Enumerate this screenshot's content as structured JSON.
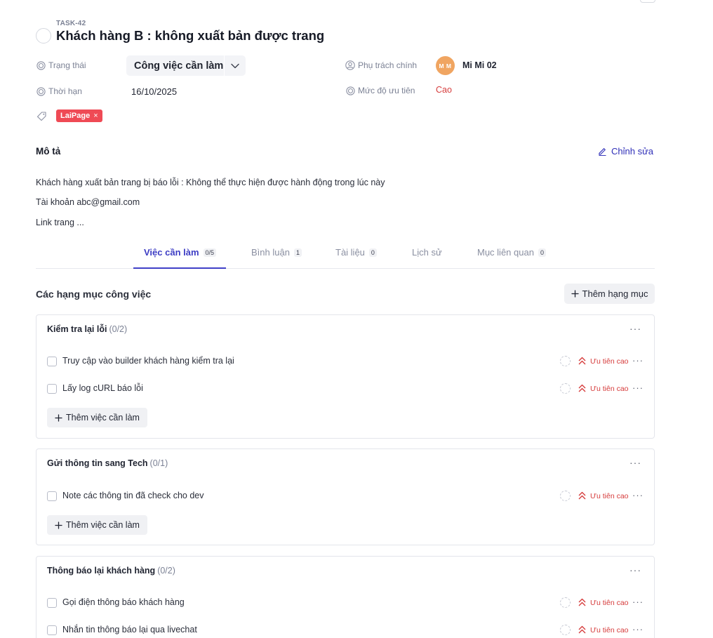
{
  "task": {
    "code": "TASK-42",
    "title": "Khách hàng B : không xuất bản được trang"
  },
  "fields": {
    "status_label": "Trạng thái",
    "status_value": "Công việc cần làm",
    "deadline_label": "Thời hạn",
    "deadline_value": "16/10/2025",
    "assignee_label": "Phụ trách chính",
    "assignee_initials": "M M",
    "assignee_name": "Mi Mi 02",
    "priority_label": "Mức độ ưu tiên",
    "priority_value": "Cao",
    "tag": "LaiPage",
    "tag_remove": "×"
  },
  "description": {
    "title": "Mô tả",
    "edit_label": "Chỉnh sửa",
    "lines": [
      "Khách hàng xuất bản trang bị báo lỗi : Không thể thực hiện được hành động trong lúc này",
      "Tài khoản abc@gmail.com",
      "Link trang ..."
    ]
  },
  "tabs": [
    {
      "label": "Việc cần làm",
      "badge": "0/5",
      "active": true
    },
    {
      "label": "Bình luận",
      "badge": "1"
    },
    {
      "label": "Tài liệu",
      "badge": "0"
    },
    {
      "label": "Lịch sử",
      "badge": ""
    },
    {
      "label": "Mục liên quan",
      "badge": "0"
    }
  ],
  "checklist": {
    "title": "Các hạng mục công việc",
    "add_group_label": "Thêm hạng mục",
    "add_todo_label": "Thêm việc cần làm",
    "groups": [
      {
        "name": "Kiểm tra lại lỗi",
        "count": "(0/2)",
        "items": [
          {
            "label": "Truy cập vào builder khách hàng kiểm tra lại",
            "priority": "Ưu tiên cao"
          },
          {
            "label": "Lấy log cURL báo lỗi",
            "priority": "Ưu tiên cao"
          }
        ]
      },
      {
        "name": "Gửi thông tin sang Tech",
        "count": "(0/1)",
        "items": [
          {
            "label": "Note các thông tin đã check cho dev",
            "priority": "Ưu tiên cao"
          }
        ]
      },
      {
        "name": "Thông báo lại khách hàng",
        "count": "(0/2)",
        "items": [
          {
            "label": "Gọi điện thông báo khách hàng",
            "priority": "Ưu tiên cao"
          },
          {
            "label": "Nhắn tin thông báo lại qua livechat",
            "priority": "Ưu tiên cao"
          }
        ]
      }
    ]
  },
  "colors": {
    "accent": "#3d3dc4",
    "danger": "#d63c3c",
    "tag_bg": "#ef4a55",
    "avatar_bg": "#f0a561"
  },
  "icons": {
    "status": "target-circle-icon",
    "deadline": "target-circle-icon",
    "assignee": "user-circle-icon",
    "priority": "target-circle-icon",
    "tag": "tag-icon",
    "edit": "pencil-icon",
    "chevron": "chevron-down-icon",
    "priority_high": "double-chevron-up-icon",
    "more": "more-horizontal-icon",
    "add": "plus-icon"
  }
}
